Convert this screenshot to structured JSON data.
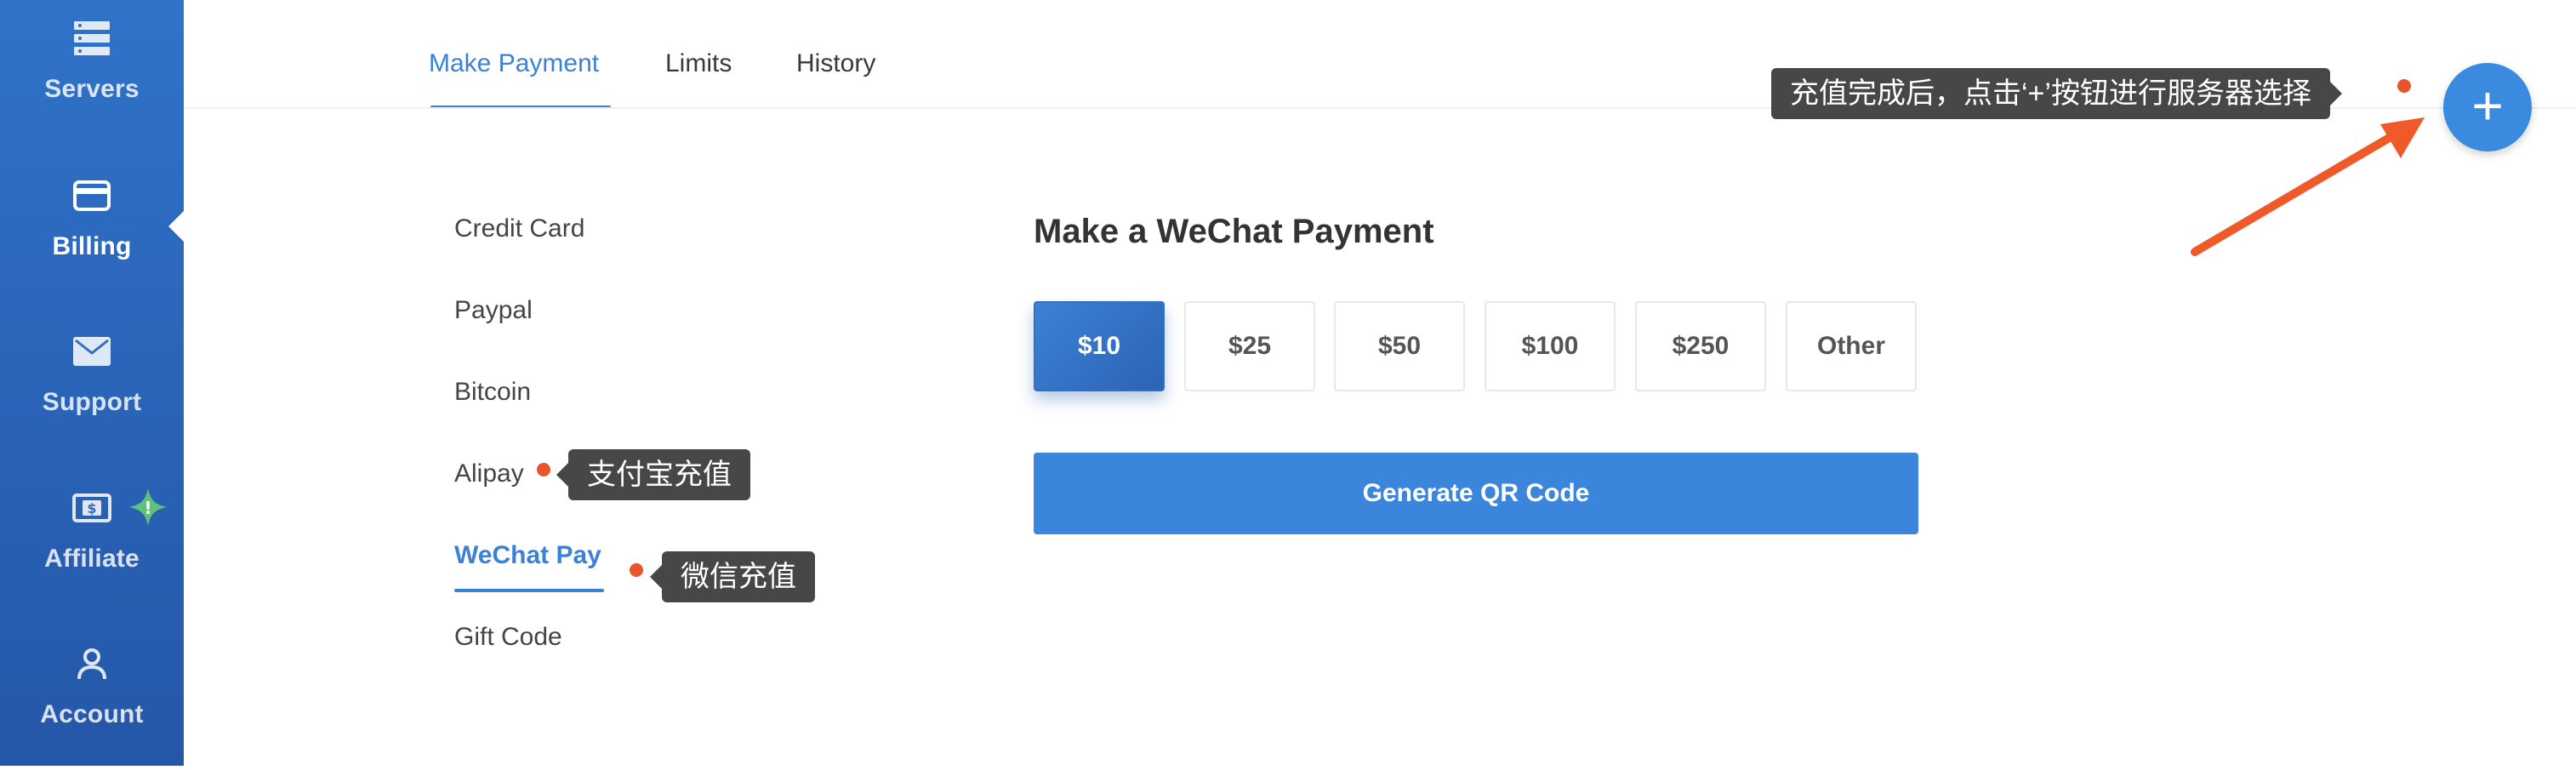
{
  "sidebar": {
    "items": [
      {
        "label": "Servers",
        "icon": "server-icon"
      },
      {
        "label": "Billing",
        "icon": "credit-card-icon",
        "active": true
      },
      {
        "label": "Support",
        "icon": "envelope-icon"
      },
      {
        "label": "Affiliate",
        "icon": "dollar-bill-icon"
      },
      {
        "label": "Account",
        "icon": "user-icon"
      }
    ],
    "affiliate_badge": "!"
  },
  "tabs": [
    {
      "label": "Make Payment",
      "active": true
    },
    {
      "label": "Limits"
    },
    {
      "label": "History"
    }
  ],
  "methods": [
    {
      "label": "Credit Card"
    },
    {
      "label": "Paypal"
    },
    {
      "label": "Bitcoin"
    },
    {
      "label": "Alipay"
    },
    {
      "label": "WeChat Pay",
      "active": true
    },
    {
      "label": "Gift Code"
    }
  ],
  "panel": {
    "title": "Make a WeChat Payment",
    "amounts": [
      "$10",
      "$25",
      "$50",
      "$100",
      "$250",
      "Other"
    ],
    "selected_amount": "$10",
    "generate_label": "Generate QR Code"
  },
  "annotations": {
    "alipay_tip": "支付宝充值",
    "wechat_tip": "微信充值",
    "fab_tip": "充值完成后，点击‘+’按钮进行服务器选择"
  },
  "fab": {
    "symbol": "+"
  },
  "colors": {
    "sidebar": "#2a64b8",
    "accent": "#3b82d6",
    "annotation_dot": "#e8542c",
    "arrow": "#f05a2a"
  }
}
